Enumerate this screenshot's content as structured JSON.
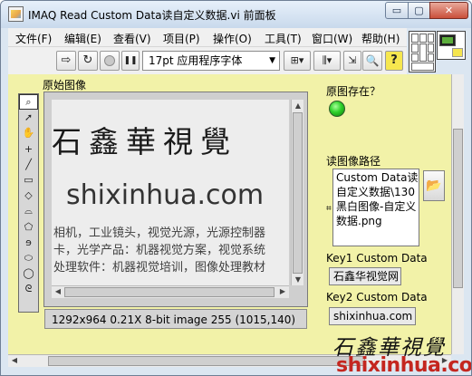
{
  "window": {
    "title": "IMAQ Read Custom Data读自定义数据.vi 前面板",
    "controls": {
      "minimize": "▭",
      "maximize": "▢",
      "close": "✕"
    }
  },
  "menu": {
    "items": [
      "文件(F)",
      "编辑(E)",
      "查看(V)",
      "项目(P)",
      "操作(O)",
      "工具(T)",
      "窗口(W)",
      "帮助(H)"
    ]
  },
  "toolbar": {
    "run_icon": "⇨",
    "run_continuous_icon": "↻",
    "pause_icon": "❚❚",
    "font_setting": "17pt 应用程序字体",
    "help_icon": "?",
    "search_icon": "🔍"
  },
  "front_panel": {
    "image_label": "原始图像",
    "image_content": {
      "calligraphy": "石鑫華視覺",
      "brand": "shixinhua.com",
      "lines": [
        "相机，工业镜头，视觉光源，光源控制器",
        "卡，光学产品：机器视觉方案，视觉系统",
        "处理软件：机器视觉培训，图像处理教材"
      ]
    },
    "image_info": "1292x964 0.21X 8-bit image 255    (1015,140)",
    "exists_label": "原图存在？",
    "exists_state": "true",
    "led_color": "#2fd12a",
    "path_label": "读图像路径",
    "path_value": "Custom Data读自定义数据\\130黑白图像-自定义数据.png",
    "key1_label": "Key1 Custom Data",
    "key1_value": "石鑫华视觉网",
    "key2_label": "Key2 Custom Data",
    "key2_value": "shixinhua.com"
  },
  "tools": [
    "zoom-tool",
    "pointer-tool",
    "pan-tool",
    "point-tool",
    "line-tool",
    "rectangle-tool",
    "rotated-rect-tool",
    "annulus-tool",
    "polygon-tool",
    "freehand-tool",
    "oval-tool",
    "broken-line-tool",
    "freehand-line-tool"
  ],
  "tool_glyphs": [
    "⌕",
    "➚",
    "✋",
    "+",
    "╱",
    "▭",
    "◇",
    "⌓",
    "⬠",
    "ɘ",
    "⬭",
    "◯",
    "ᘓ"
  ],
  "watermark": {
    "calligraphy": "石鑫華視覺",
    "site": "shixinhua.com"
  }
}
